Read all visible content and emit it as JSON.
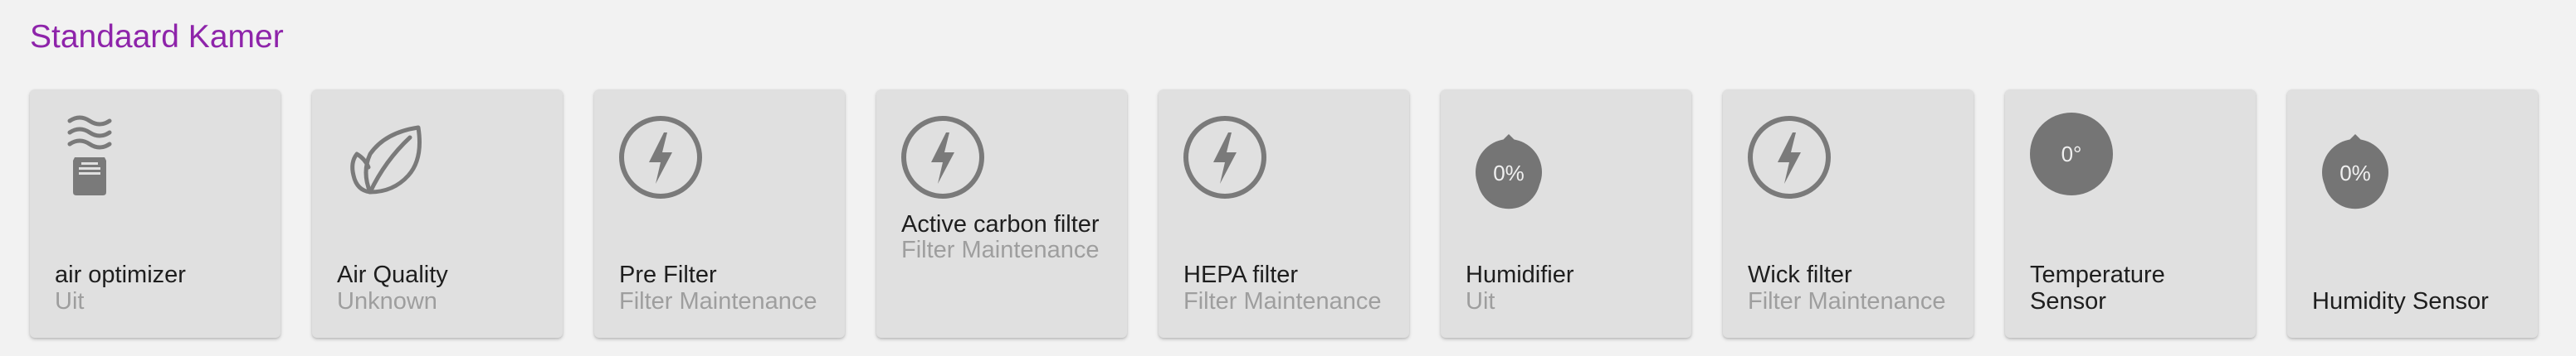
{
  "room": {
    "title": "Standaard Kamer"
  },
  "colors": {
    "accent": "#8e24aa",
    "tile_background": "#e0e0e0",
    "icon": "#7a7a7a",
    "badge": "#757575"
  },
  "tiles": [
    {
      "name": "air optimizer",
      "state": "Uit",
      "icon": "air-purifier-icon"
    },
    {
      "name": "Air Quality",
      "state": "Unknown",
      "icon": "leaf-icon"
    },
    {
      "name": "Pre Filter",
      "state": "Filter Maintenance",
      "icon": "lightning-icon"
    },
    {
      "name": "Active carbon filter",
      "state": "Filter Maintenance",
      "icon": "lightning-icon"
    },
    {
      "name": "HEPA filter",
      "state": "Filter Maintenance",
      "icon": "lightning-icon"
    },
    {
      "name": "Humidifier",
      "state": "Uit",
      "icon": "water-drop-icon",
      "badge": "0%"
    },
    {
      "name": "Wick filter",
      "state": "Filter Maintenance",
      "icon": "lightning-icon"
    },
    {
      "name": "Temperature Sensor",
      "state": "",
      "icon": "temperature-badge-icon",
      "badge": "0°"
    },
    {
      "name": "Humidity Sensor",
      "state": "",
      "icon": "water-drop-icon",
      "badge": "0%"
    }
  ]
}
